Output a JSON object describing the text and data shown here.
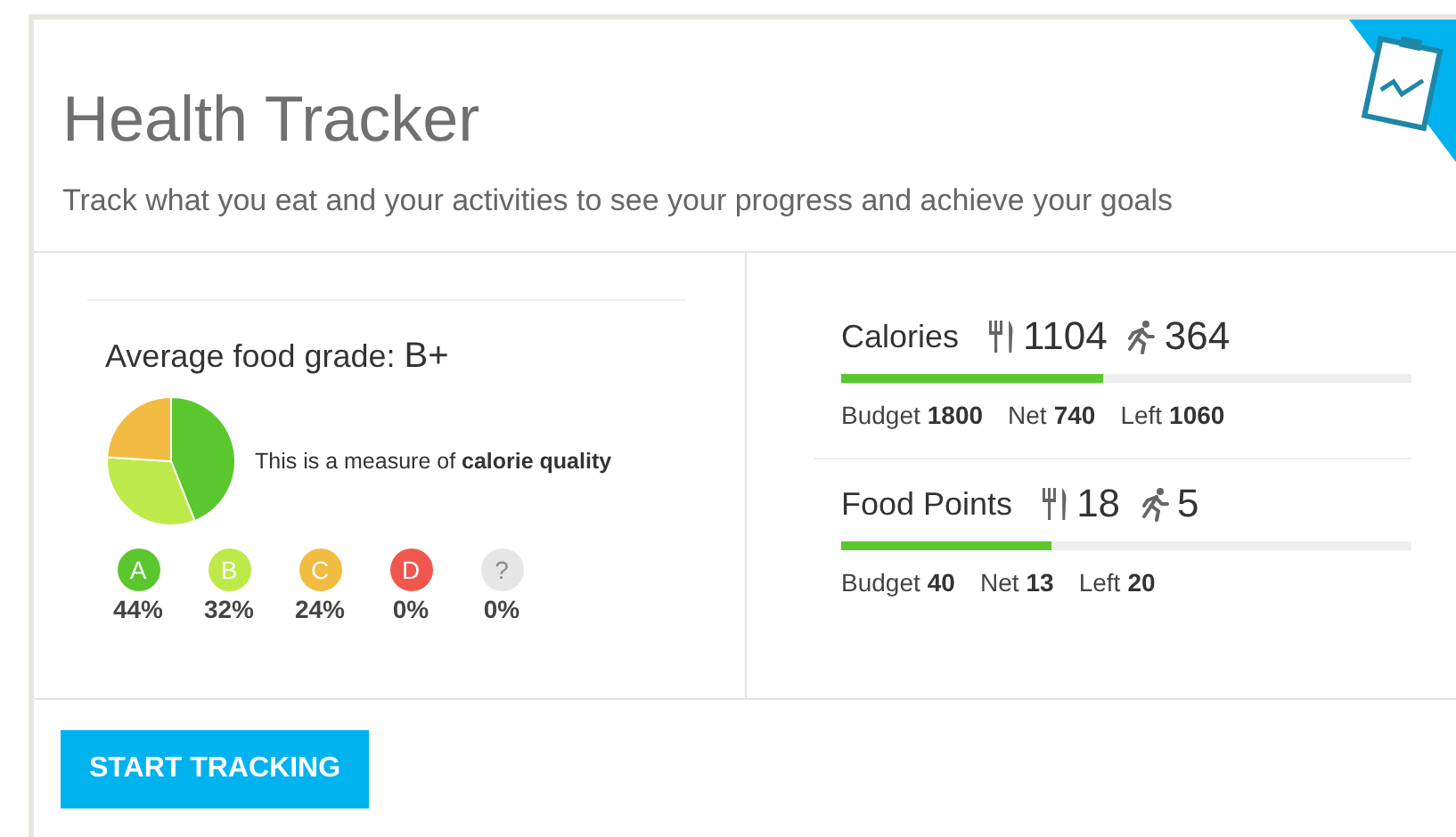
{
  "header": {
    "title": "Health Tracker",
    "subtitle": "Track what you eat and your activities to see your progress and achieve your goals"
  },
  "food_grade": {
    "label": "Average food grade:",
    "grade": "B+",
    "note": "This is a measure of **calorie quality**",
    "chart_data": {
      "type": "pie",
      "categories": [
        "A",
        "B",
        "C",
        "D",
        "?"
      ],
      "values": [
        44,
        32,
        24,
        0,
        0
      ]
    },
    "grades": [
      {
        "percent": "44%",
        "color": "#5ac72e"
      },
      {
        "percent": "32%",
        "color": "#bdea4a"
      },
      {
        "percent": "24%",
        "color": "#f2bb41"
      },
      {
        "percent": "0%",
        "color": "#f0574e"
      },
      {
        "percent": "0%",
        "color": "#e6e6e6"
      }
    ]
  },
  "metrics": [
    {
      "title": "Calories",
      "eaten": "1104",
      "burned": "364",
      "level": 0.46,
      "stats": [
        {
          "label": "Budget",
          "value": "1800"
        },
        {
          "label": "Net",
          "value": "740"
        },
        {
          "label": "Left",
          "value": "1060"
        }
      ]
    },
    {
      "title": "Food Points",
      "eaten": "18",
      "burned": "5",
      "level": 0.37,
      "stats": [
        {
          "label": "Budget",
          "value": "40"
        },
        {
          "label": "Net",
          "value": "13"
        },
        {
          "label": "Left",
          "value": "20"
        }
      ]
    }
  ],
  "button": {
    "label": "START TRACKING"
  }
}
